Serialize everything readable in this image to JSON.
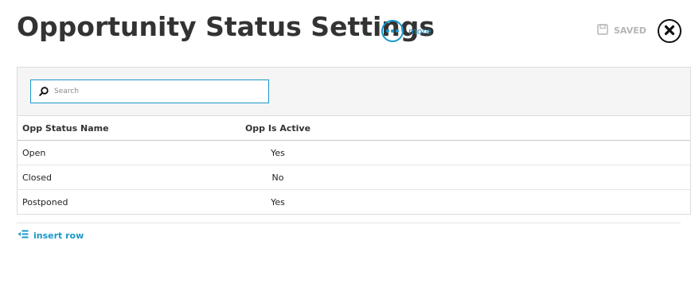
{
  "header": {
    "title": "Opportunity Status Settings",
    "more_label": "more",
    "saved_label": "SAVED"
  },
  "search": {
    "placeholder": "Search"
  },
  "table": {
    "columns": [
      "Opp Status Name",
      "Opp Is Active"
    ],
    "rows": [
      {
        "name": "Open",
        "active": "Yes"
      },
      {
        "name": "Closed",
        "active": "No"
      },
      {
        "name": "Postponed",
        "active": "Yes"
      }
    ]
  },
  "footer": {
    "insert_label": "insert row"
  },
  "colors": {
    "accent": "#1a98c9",
    "muted": "#b5b5b5",
    "text": "#333333"
  },
  "icons": {
    "more": "ellipsis-circle-icon",
    "saved": "floppy-disk-icon",
    "close": "close-circle-icon",
    "search": "search-icon",
    "insert": "insert-row-icon"
  }
}
